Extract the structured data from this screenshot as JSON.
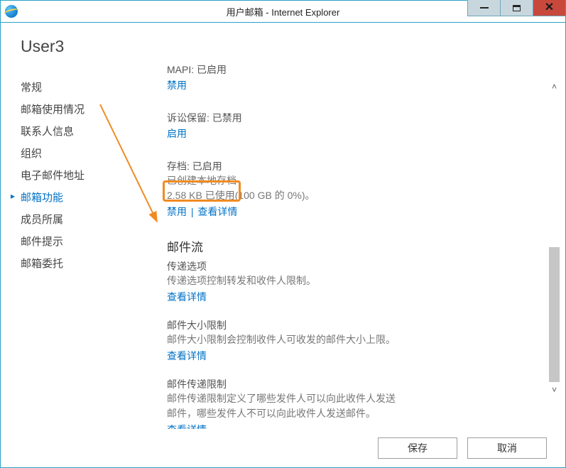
{
  "window": {
    "title": "用户邮箱 - Internet Explorer"
  },
  "user_heading": "User3",
  "sidebar": {
    "items": [
      {
        "label": "常规"
      },
      {
        "label": "邮箱使用情况"
      },
      {
        "label": "联系人信息"
      },
      {
        "label": "组织"
      },
      {
        "label": "电子邮件地址"
      },
      {
        "label": "邮箱功能"
      },
      {
        "label": "成员所属"
      },
      {
        "label": "邮件提示"
      },
      {
        "label": "邮箱委托"
      }
    ],
    "active_index": 5
  },
  "sections": {
    "mapi": {
      "label": "MAPI: 已启用",
      "action": "禁用"
    },
    "litigation": {
      "label": "诉讼保留: 已禁用",
      "action": "启用"
    },
    "archive": {
      "label": "存档: 已启用",
      "line1": "已创建本地存档",
      "line2": "2.58 KB 已使用(100 GB 的 0%)。",
      "action1": "禁用",
      "sep": " | ",
      "action2": "查看详情"
    },
    "mailflow": {
      "title": "邮件流",
      "delivery": {
        "label": "传递选项",
        "desc": "传递选项控制转发和收件人限制。",
        "action": "查看详情"
      },
      "size": {
        "label": "邮件大小限制",
        "desc": "邮件大小限制会控制收件人可收发的邮件大小上限。",
        "action": "查看详情"
      },
      "restrict": {
        "label": "邮件传递限制",
        "desc": "邮件传递限制定义了哪些发件人可以向此收件人发送邮件，哪些发件人不可以向此收件人发送邮件。",
        "action": "查看详情"
      }
    }
  },
  "buttons": {
    "save": "保存",
    "cancel": "取消"
  }
}
